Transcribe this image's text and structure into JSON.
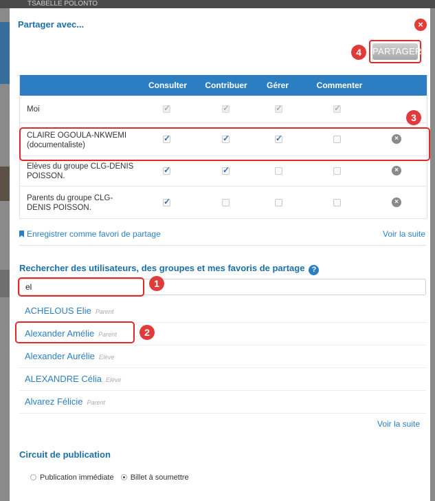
{
  "background": {
    "top_text": "TSABELLE POLONTO"
  },
  "dialog": {
    "title": "Partager avec...",
    "share_button": "PARTAGER",
    "badges": [
      "1",
      "2",
      "3",
      "4"
    ]
  },
  "permissions": {
    "columns": [
      "Consulter",
      "Contribuer",
      "Gérer",
      "Commenter"
    ],
    "rows": [
      {
        "name": "Moi",
        "checks": [
          "locked",
          "locked",
          "locked",
          "locked"
        ],
        "removable": false
      },
      {
        "name": "CLAIRE OGOULA-NKWEMI (documentaliste)",
        "checks": [
          "on",
          "on",
          "on",
          "off"
        ],
        "removable": true
      },
      {
        "name": "Elèves du groupe CLG-DENIS POISSON.",
        "checks": [
          "on",
          "on",
          "off",
          "off"
        ],
        "removable": true
      },
      {
        "name": "Parents du groupe CLG-DENIS POISSON.",
        "checks": [
          "on",
          "off",
          "off",
          "off"
        ],
        "removable": true
      }
    ]
  },
  "favorites": {
    "save_label": "Enregistrer comme favori de partage",
    "more": "Voir la suite"
  },
  "search": {
    "label": "Rechercher des utilisateurs, des groupes et mes favoris de partage",
    "help_icon": "?",
    "value": "el",
    "results": [
      {
        "name": "ACHELOUS Elie",
        "type": "Parent"
      },
      {
        "name": "Alexander Amélie",
        "type": "Parent"
      },
      {
        "name": "Alexander Aurélie",
        "type": "Elève"
      },
      {
        "name": "ALEXANDRE Célia",
        "type": "Elève"
      },
      {
        "name": "Alvarez Félicie",
        "type": "Parent"
      }
    ],
    "more": "Voir la suite"
  },
  "publication": {
    "title": "Circuit de publication",
    "options": [
      {
        "label": "Publication immédiate",
        "selected": false
      },
      {
        "label": "Billet à soumettre",
        "selected": true
      }
    ]
  },
  "colors": {
    "accent": "#2c7ec2",
    "title": "#1b6fa6",
    "highlight": "#e02a2a"
  }
}
